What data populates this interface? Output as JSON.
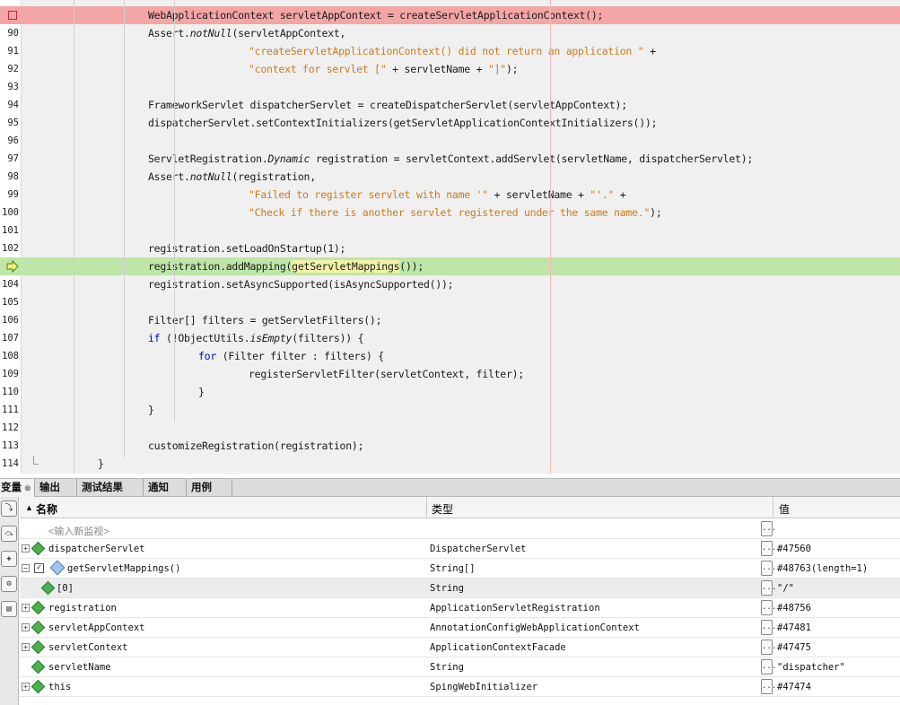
{
  "editor": {
    "lines": [
      {
        "num": "",
        "marker": "breakpoint",
        "highlight": "breakpoint",
        "indent": 2,
        "segments": [
          {
            "t": "WebApplicationContext servletAppContext = createServletApplicationContext();",
            "c": ""
          }
        ]
      },
      {
        "num": "90",
        "indent": 2,
        "segments": [
          {
            "t": "Assert.",
            "c": ""
          },
          {
            "t": "notNull",
            "c": "it"
          },
          {
            "t": "(servletAppContext,",
            "c": ""
          }
        ]
      },
      {
        "num": "91",
        "indent": 4,
        "segments": [
          {
            "t": "\"createServletApplicationContext() did not return an application \"",
            "c": "str"
          },
          {
            "t": " +",
            "c": ""
          }
        ]
      },
      {
        "num": "92",
        "indent": 4,
        "segments": [
          {
            "t": "\"context for servlet [\"",
            "c": "str"
          },
          {
            "t": " + servletName + ",
            "c": ""
          },
          {
            "t": "\"]\"",
            "c": "str"
          },
          {
            "t": ");",
            "c": ""
          }
        ]
      },
      {
        "num": "93",
        "indent": 2,
        "segments": []
      },
      {
        "num": "94",
        "indent": 2,
        "segments": [
          {
            "t": "FrameworkServlet dispatcherServlet = createDispatcherServlet(servletAppContext);",
            "c": ""
          }
        ]
      },
      {
        "num": "95",
        "indent": 2,
        "segments": [
          {
            "t": "dispatcherServlet.setContextInitializers(getServletApplicationContextInitializers());",
            "c": ""
          }
        ]
      },
      {
        "num": "96",
        "indent": 2,
        "segments": []
      },
      {
        "num": "97",
        "indent": 2,
        "segments": [
          {
            "t": "ServletRegistration.",
            "c": ""
          },
          {
            "t": "Dynamic",
            "c": "it"
          },
          {
            "t": " registration = servletContext.addServlet(servletName, dispatcherServlet);",
            "c": ""
          }
        ]
      },
      {
        "num": "98",
        "indent": 2,
        "segments": [
          {
            "t": "Assert.",
            "c": ""
          },
          {
            "t": "notNull",
            "c": "it"
          },
          {
            "t": "(registration,",
            "c": ""
          }
        ]
      },
      {
        "num": "99",
        "indent": 4,
        "segments": [
          {
            "t": "\"Failed to register servlet with name '\"",
            "c": "str"
          },
          {
            "t": " + servletName + ",
            "c": ""
          },
          {
            "t": "\"'.\"",
            "c": "str"
          },
          {
            "t": " +",
            "c": ""
          }
        ]
      },
      {
        "num": "100",
        "indent": 4,
        "segments": [
          {
            "t": "\"Check if there is another servlet registered under the same name.\"",
            "c": "str"
          },
          {
            "t": ");",
            "c": ""
          }
        ]
      },
      {
        "num": "101",
        "indent": 2,
        "segments": []
      },
      {
        "num": "102",
        "indent": 2,
        "segments": [
          {
            "t": "registration.setLoadOnStartup(1);",
            "c": ""
          }
        ]
      },
      {
        "num": "",
        "marker": "current",
        "highlight": "current",
        "indent": 2,
        "segments": [
          {
            "t": "registration.addMapping(",
            "c": ""
          },
          {
            "t": "getServletMappings",
            "c": "hl"
          },
          {
            "t": "());",
            "c": ""
          }
        ]
      },
      {
        "num": "104",
        "indent": 2,
        "segments": [
          {
            "t": "registration.setAsyncSupported(isAsyncSupported());",
            "c": ""
          }
        ]
      },
      {
        "num": "105",
        "indent": 2,
        "segments": []
      },
      {
        "num": "106",
        "indent": 2,
        "segments": [
          {
            "t": "Filter[] filters = getServletFilters();",
            "c": ""
          }
        ]
      },
      {
        "num": "107",
        "indent": 2,
        "segments": [
          {
            "t": "if",
            "c": "kw"
          },
          {
            "t": " (!ObjectUtils.",
            "c": ""
          },
          {
            "t": "isEmpty",
            "c": "it"
          },
          {
            "t": "(filters)) {",
            "c": ""
          }
        ]
      },
      {
        "num": "108",
        "indent": 3,
        "segments": [
          {
            "t": "for",
            "c": "kw"
          },
          {
            "t": " (Filter filter : filters) {",
            "c": ""
          }
        ]
      },
      {
        "num": "109",
        "indent": 4,
        "segments": [
          {
            "t": "registerServletFilter(servletContext, filter);",
            "c": ""
          }
        ]
      },
      {
        "num": "110",
        "indent": 3,
        "segments": [
          {
            "t": "}",
            "c": ""
          }
        ]
      },
      {
        "num": "111",
        "indent": 2,
        "segments": [
          {
            "t": "}",
            "c": ""
          }
        ]
      },
      {
        "num": "112",
        "indent": 2,
        "segments": []
      },
      {
        "num": "113",
        "indent": 2,
        "segments": [
          {
            "t": "customizeRegistration(registration);",
            "c": ""
          }
        ]
      },
      {
        "num": "114",
        "indent": 1,
        "segments": [
          {
            "t": "}",
            "c": ""
          }
        ]
      }
    ]
  },
  "tabs": [
    {
      "label": "变量",
      "close": "⊗",
      "active": true
    },
    {
      "label": "输出"
    },
    {
      "label": "测试结果"
    },
    {
      "label": "通知"
    },
    {
      "label": "用例"
    }
  ],
  "variables": {
    "headers": {
      "name": "名称",
      "type": "类型",
      "value": "值"
    },
    "sort_indicator": "▲",
    "new_watch_placeholder": "<输入新监视>",
    "ellipsis": "...",
    "rows": [
      {
        "expander": "+",
        "icon": "green",
        "name": "dispatcherServlet",
        "type": "DispatcherServlet",
        "value": "#47560"
      },
      {
        "expander": "−",
        "checkbox": "✓",
        "icon": "blue",
        "name": "getServletMappings()",
        "type": "String[]",
        "value": "#48763(length=1)"
      },
      {
        "icon": "green",
        "nested": true,
        "selected": true,
        "name": "[0]",
        "type": "String",
        "value": "\"/\""
      },
      {
        "expander": "+",
        "icon": "green",
        "name": "registration",
        "type": "ApplicationServletRegistration",
        "value": "#48756"
      },
      {
        "expander": "+",
        "icon": "green",
        "name": "servletAppContext",
        "type": "AnnotationConfigWebApplicationContext",
        "value": "#47481"
      },
      {
        "expander": "+",
        "icon": "green",
        "name": "servletContext",
        "type": "ApplicationContextFacade",
        "value": "#47475"
      },
      {
        "icon": "green",
        "name": "servletName",
        "type": "String",
        "value": "\"dispatcher\""
      },
      {
        "expander": "+",
        "icon": "green",
        "name": "this",
        "type": "SpingWebInitializer",
        "value": "#47474"
      }
    ]
  },
  "sidetools": [
    "step-over-icon",
    "step-into-icon",
    "add-watch-icon",
    "settings-icon",
    "layout-icon"
  ],
  "colors": {
    "breakpoint_line": "#f4a5a5",
    "current_line": "#bfe6a8",
    "string": "#d07a16",
    "keyword": "#0000c8"
  }
}
